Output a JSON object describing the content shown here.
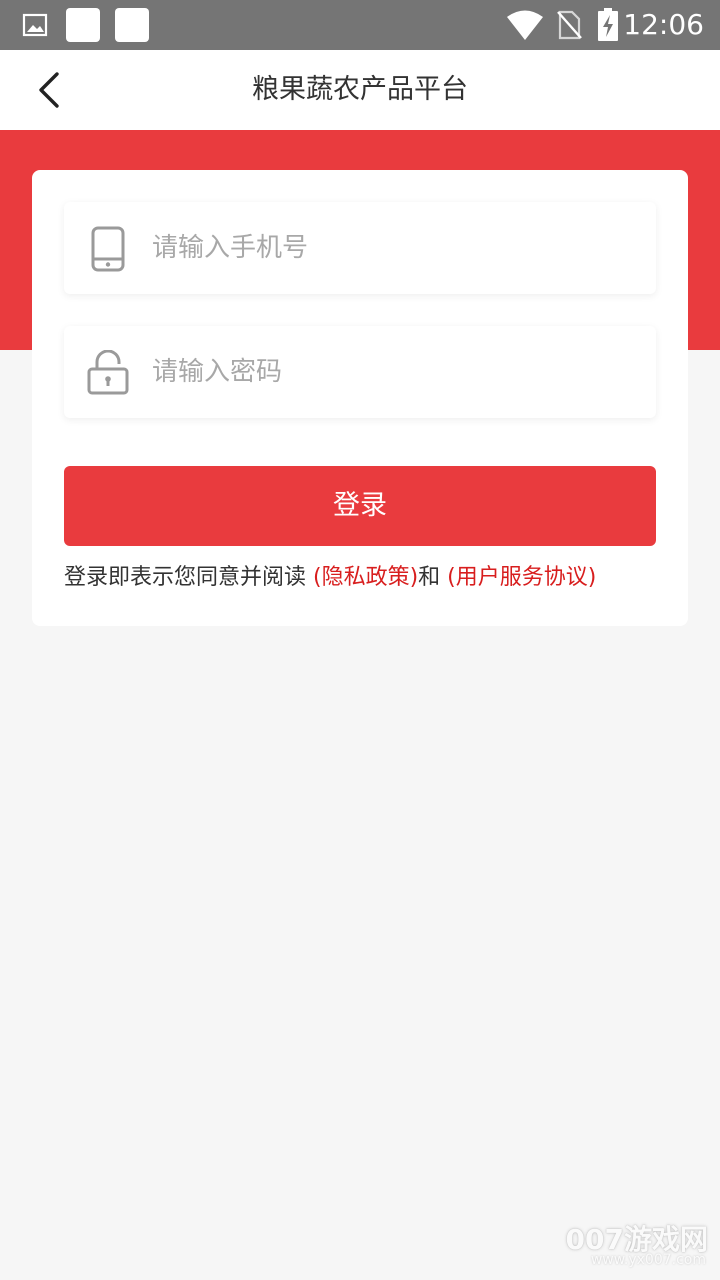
{
  "status_bar": {
    "time": "12:06",
    "icons": [
      "gallery-icon",
      "notification-square-icon",
      "notification-square-icon",
      "wifi-icon",
      "no-sim-icon",
      "battery-charging-icon"
    ]
  },
  "app_bar": {
    "back_icon": "chevron-left-icon",
    "title": "粮果蔬农产品平台"
  },
  "login_form": {
    "phone": {
      "icon": "phone-icon",
      "value": "",
      "placeholder": "请输入手机号"
    },
    "password": {
      "icon": "lock-icon",
      "value": "",
      "placeholder": "请输入密码"
    },
    "login_label": "登录",
    "agreement": {
      "prefix": "登录即表示您同意并阅读 ",
      "privacy_link": "(隐私政策)",
      "connector": "和 ",
      "terms_link": "(用户服务协议)"
    }
  },
  "watermark": {
    "main": "007游戏网",
    "sub": "www.yx007.com"
  },
  "colors": {
    "accent": "#e93b3e",
    "link": "#d81e1e",
    "status_bar": "#757575",
    "background": "#f6f6f6"
  }
}
